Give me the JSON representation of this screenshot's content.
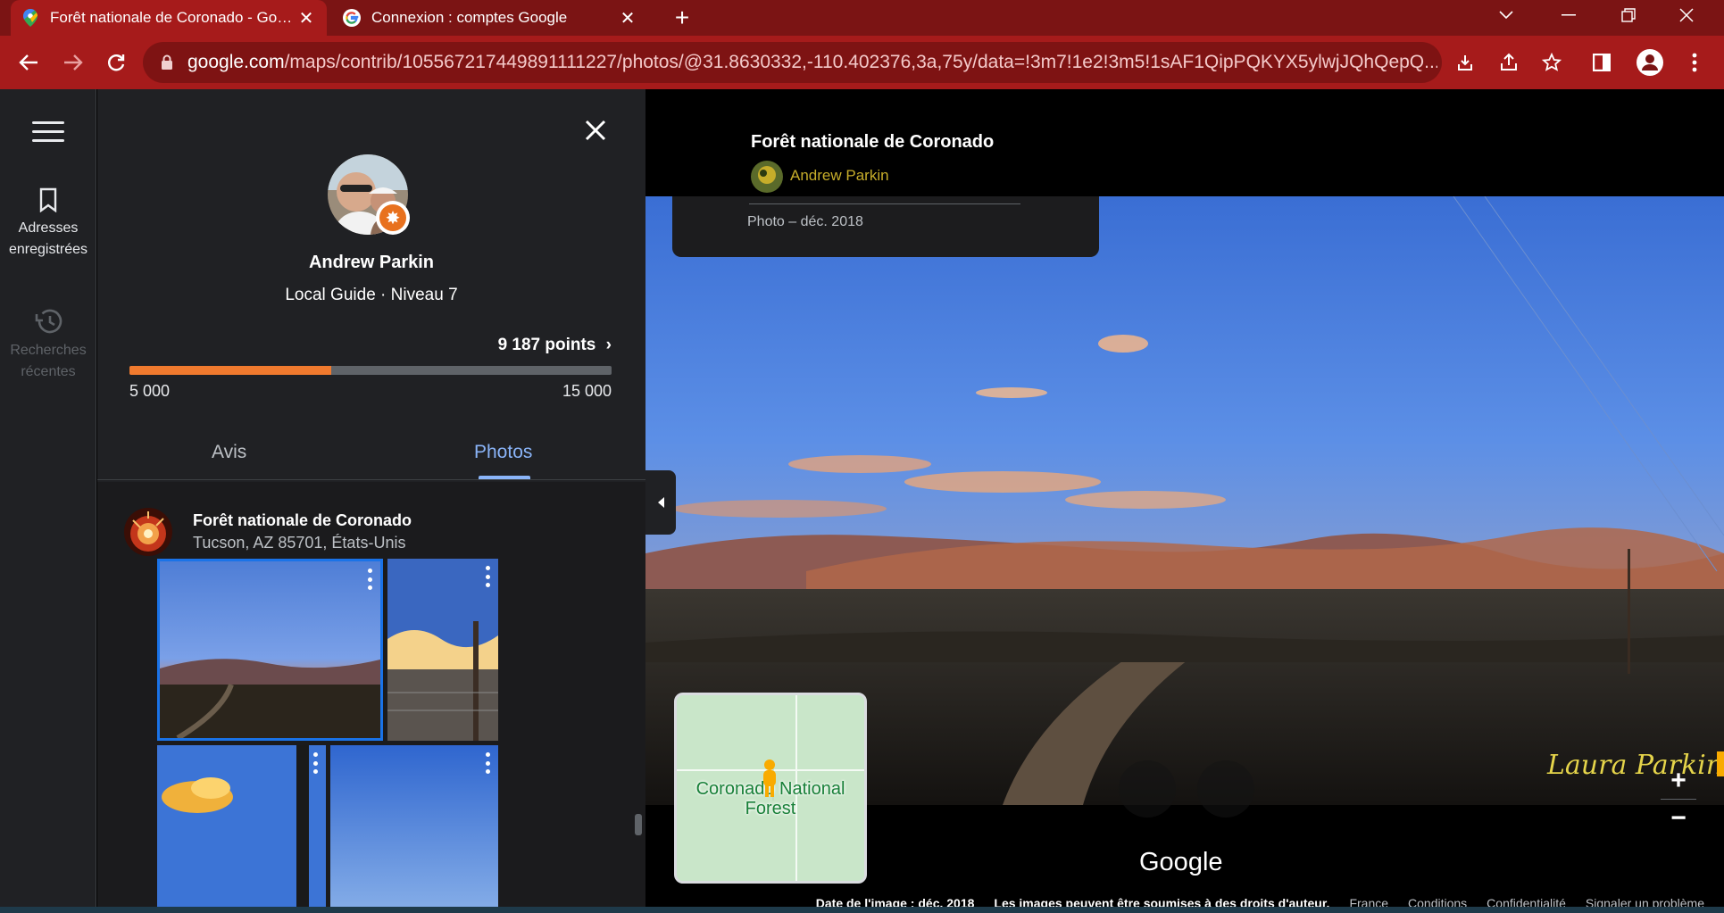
{
  "browser": {
    "tabs": [
      {
        "title": "Forêt nationale de Coronado - Google Maps",
        "active": true
      },
      {
        "title": "Connexion : comptes Google",
        "active": false
      }
    ],
    "url_host": "google.com",
    "url_path": "/maps/contrib/105567217449891111227/photos/@31.8630332,-110.402376,3a,75y/data=!3m7!1e2!3m5!1sAF1QipPQKYX5ylwjJQhQepQ...",
    "accent": "#a61b1b"
  },
  "rail": {
    "saved_label": "Adresses enregistrées",
    "recent_label": "Recherches récentes"
  },
  "profile": {
    "name": "Andrew Parkin",
    "level": "Local Guide · Niveau 7",
    "points": "9 187 points",
    "progress_min": "5 000",
    "progress_max": "15 000",
    "progress_fraction": 0.4187,
    "tabs": [
      "Avis",
      "Photos"
    ],
    "selected_tab": "Photos"
  },
  "place": {
    "name": "Forêt nationale de Coronado",
    "address": "Tucson, AZ 85701, États-Unis"
  },
  "viewer": {
    "title": "Forêt nationale de Coronado",
    "author": "Andrew Parkin",
    "photo_info": "Photo – déc. 2018",
    "minimap_label": "Coronado National Forest",
    "signature": "Laura Parkin",
    "google_logo": "Google",
    "footer": {
      "date": "Date de l'image : déc. 2018",
      "copyright": "Les images peuvent être soumises à des droits d'auteur.",
      "country": "France",
      "terms": "Conditions",
      "privacy": "Confidentialité",
      "report": "Signaler un problème"
    }
  }
}
